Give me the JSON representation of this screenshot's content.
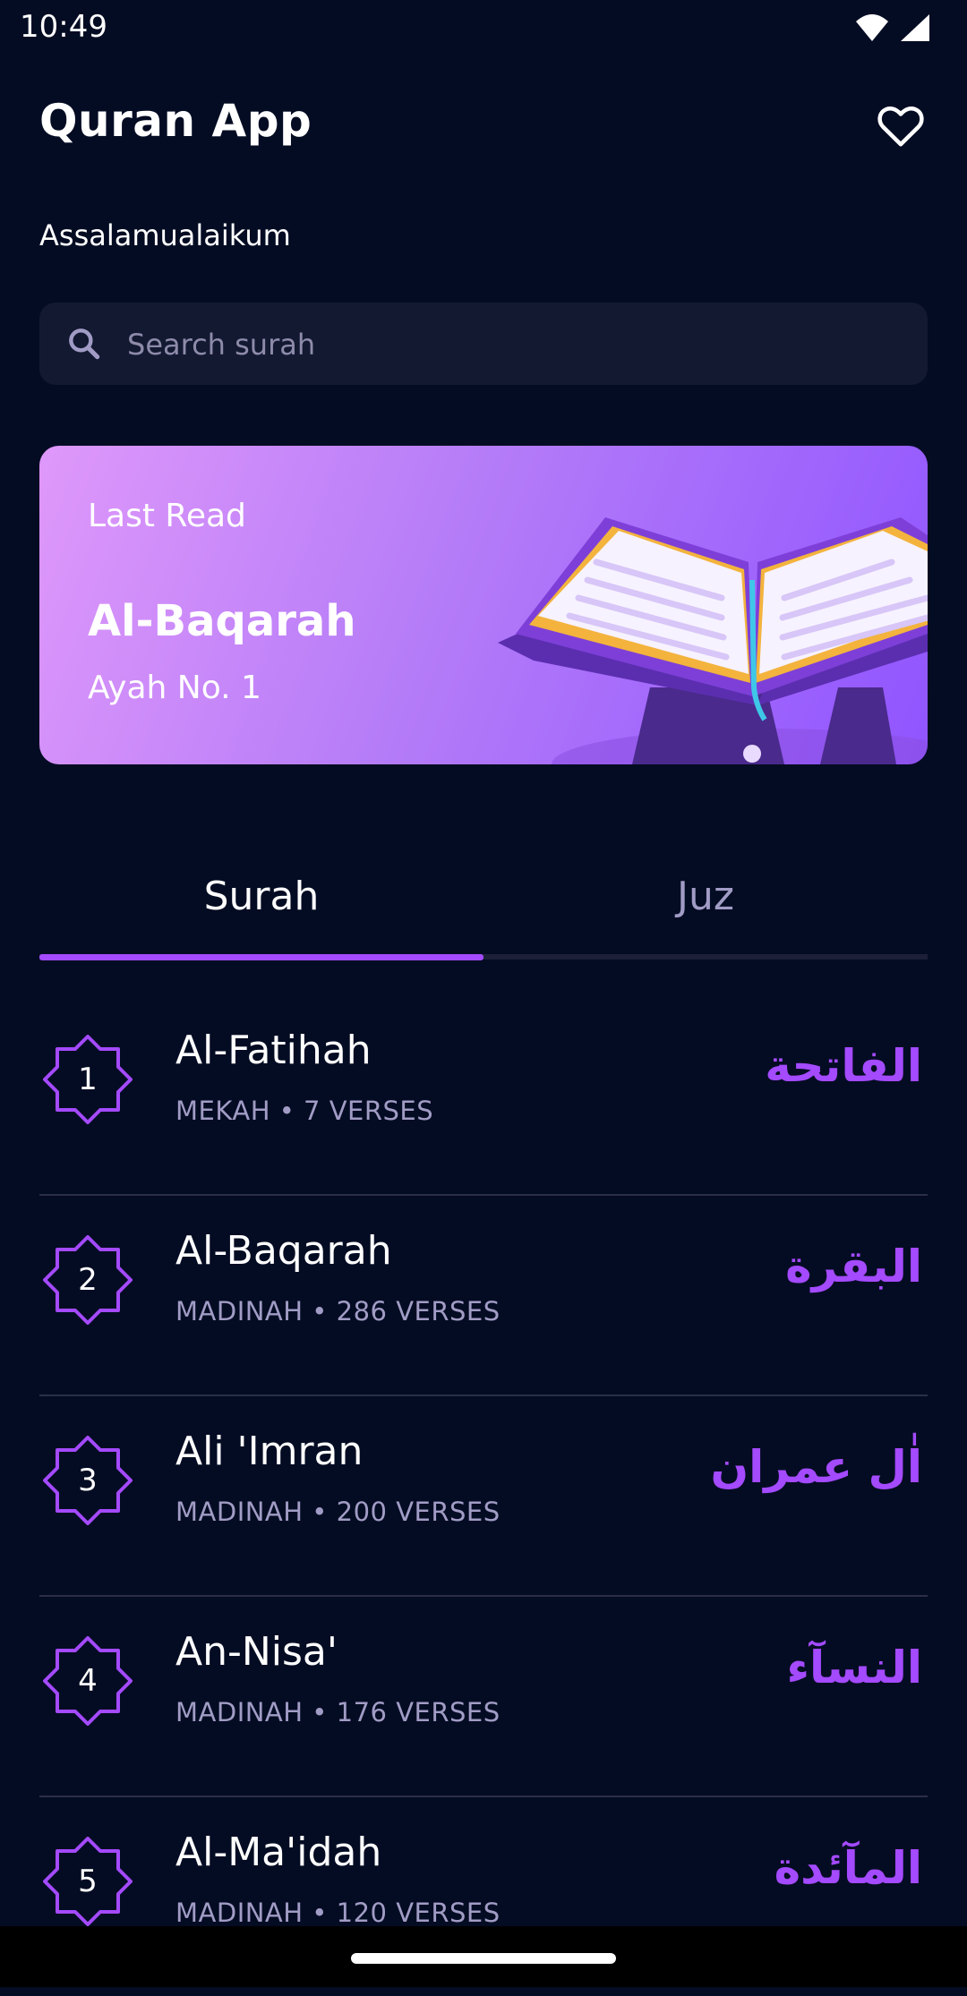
{
  "status_bar": {
    "time": "10:49"
  },
  "header": {
    "title": "Quran App",
    "favorite_icon": "heart-outline-icon"
  },
  "greeting": "Assalamualaikum",
  "search": {
    "placeholder": "Search surah",
    "icon": "search-icon"
  },
  "last_read": {
    "label": "Last Read",
    "surah": "Al-Baqarah",
    "ayah": "Ayah No. 1"
  },
  "tabs": [
    {
      "label": "Surah",
      "active": true
    },
    {
      "label": "Juz",
      "active": false
    }
  ],
  "surahs": [
    {
      "number": "1",
      "name": "Al-Fatihah",
      "meta": "MEKAH • 7 VERSES",
      "arabic": "الفاتحة"
    },
    {
      "number": "2",
      "name": "Al-Baqarah",
      "meta": "MADINAH • 286 VERSES",
      "arabic": "البقرة"
    },
    {
      "number": "3",
      "name": "Ali 'Imran",
      "meta": "MADINAH • 200 VERSES",
      "arabic": "اٰل عمران"
    },
    {
      "number": "4",
      "name": "An-Nisa'",
      "meta": "MADINAH • 176 VERSES",
      "arabic": "النسآء"
    },
    {
      "number": "5",
      "name": "Al-Ma'idah",
      "meta": "MADINAH • 120 VERSES",
      "arabic": "المآئدة"
    }
  ],
  "colors": {
    "background": "#040C23",
    "accent": "#A44AFF",
    "muted_text": "#A19CC5",
    "card": "#121931"
  }
}
